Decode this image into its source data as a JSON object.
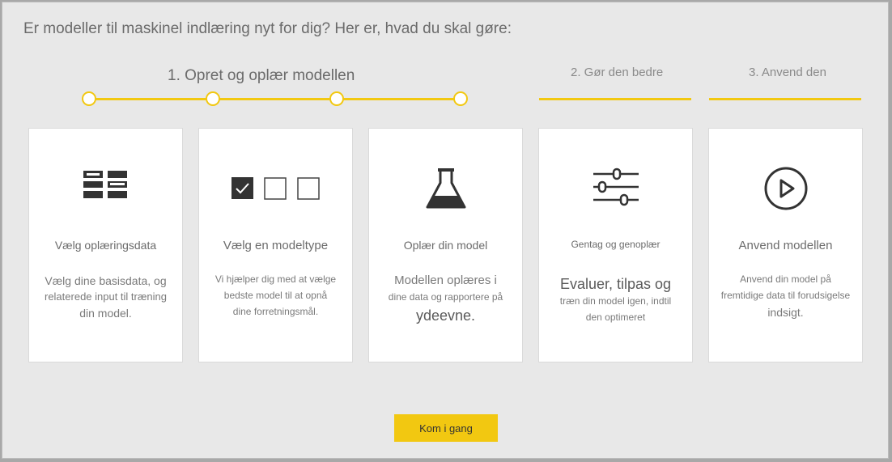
{
  "headline": "Er modeller til maskinel indlæring nyt for dig? Her er, hvad du skal gøre:",
  "steps": [
    {
      "label": "1. Opret og oplær modellen"
    },
    {
      "label": "2. Gør den bedre"
    },
    {
      "label": "3. Anvend den"
    }
  ],
  "cards": [
    {
      "icon": "table-data-icon",
      "title": "Vælg oplæringsdata",
      "desc_lines": [
        "Vælg dine basisdata, og",
        "relaterede input til træning",
        "din model."
      ]
    },
    {
      "icon": "checkboxes-icon",
      "title": "Vælg en modeltype",
      "desc_lines": [
        "Vi hjælper dig med at vælge",
        "bedste model til at opnå",
        "dine forretningsmål."
      ]
    },
    {
      "icon": "flask-icon",
      "title": "Oplær din model",
      "desc_lines": [
        "Modellen oplæres i",
        "dine data og rapportere på",
        "ydeevne."
      ]
    },
    {
      "icon": "sliders-icon",
      "title": "Gentag og genoplær",
      "desc_lines": [
        "Evaluer, tilpas og",
        "træn din model igen, indtil",
        "den optimeret"
      ]
    },
    {
      "icon": "play-circle-icon",
      "title": "Anvend modellen",
      "desc_lines": [
        "Anvend din model på",
        "fremtidige data til forudsigelse",
        "indsigt."
      ]
    }
  ],
  "cta_label": "Kom i gang",
  "colors": {
    "accent": "#f2c811",
    "background": "#e8e8e8",
    "card": "#ffffff",
    "text": "#6b6b6b"
  }
}
